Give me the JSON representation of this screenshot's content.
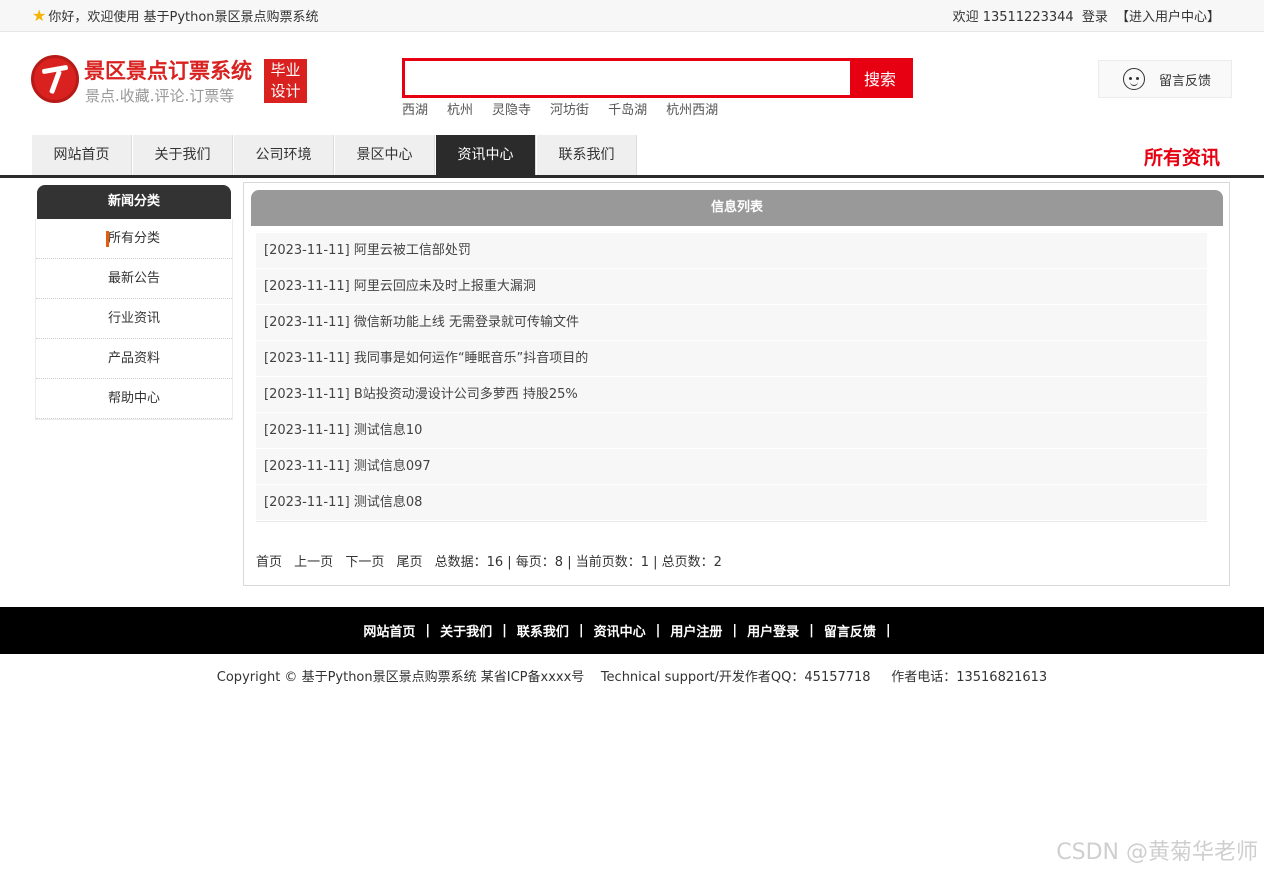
{
  "topbar": {
    "welcome": "你好，欢迎使用 基于Python景区景点购票系统",
    "user": "欢迎 13511223344",
    "login": "登录",
    "user_center": "【进入用户中心】"
  },
  "logo": {
    "title": "景区景点订票系统",
    "subtitle": "景点.收藏.评论.订票等",
    "badge_line1": "毕业",
    "badge_line2": "设计"
  },
  "search": {
    "placeholder": "",
    "button_label": "搜索",
    "hotwords": [
      "西湖",
      "杭州",
      "灵隐寺",
      "河坊街",
      "千岛湖",
      "杭州西湖"
    ]
  },
  "feedback": {
    "label": "留言反馈"
  },
  "nav": {
    "items": [
      "网站首页",
      "关于我们",
      "公司环境",
      "景区中心",
      "资讯中心",
      "联系我们"
    ],
    "active_index": 4,
    "section_title": "所有资讯"
  },
  "sidebar": {
    "title": "新闻分类",
    "items": [
      "所有分类",
      "最新公告",
      "行业资讯",
      "产品资料",
      "帮助中心"
    ]
  },
  "main": {
    "title": "信息列表",
    "news": [
      "[2023-11-11] 阿里云被工信部处罚",
      "[2023-11-11] 阿里云回应未及时上报重大漏洞",
      "[2023-11-11] 微信新功能上线 无需登录就可传输文件",
      "[2023-11-11] 我同事是如何运作“睡眠音乐”抖音项目的",
      "[2023-11-11] B站投资动漫设计公司多萝西 持股25%",
      "[2023-11-11] 测试信息10",
      "[2023-11-11] 测试信息097",
      "[2023-11-11] 测试信息08"
    ],
    "pager": {
      "first": "首页",
      "prev": "上一页",
      "next": "下一页",
      "last": "尾页",
      "summary": "总数据：16 | 每页：8 | 当前页数：1 | 总页数：2"
    }
  },
  "footer": {
    "links": [
      "网站首页",
      "关于我们",
      "联系我们",
      "资讯中心",
      "用户注册",
      "用户登录",
      "留言反馈"
    ],
    "copyright": "Copyright © 基于Python景区景点购票系统 某省ICP备xxxx号    Technical support/开发作者QQ：45157718     作者电话：13516821613"
  },
  "watermark": "CSDN @黄菊华老师",
  "colors": {
    "accent": "#e60012",
    "nav_active": "#2b2b2b",
    "header_gray": "#999999"
  }
}
